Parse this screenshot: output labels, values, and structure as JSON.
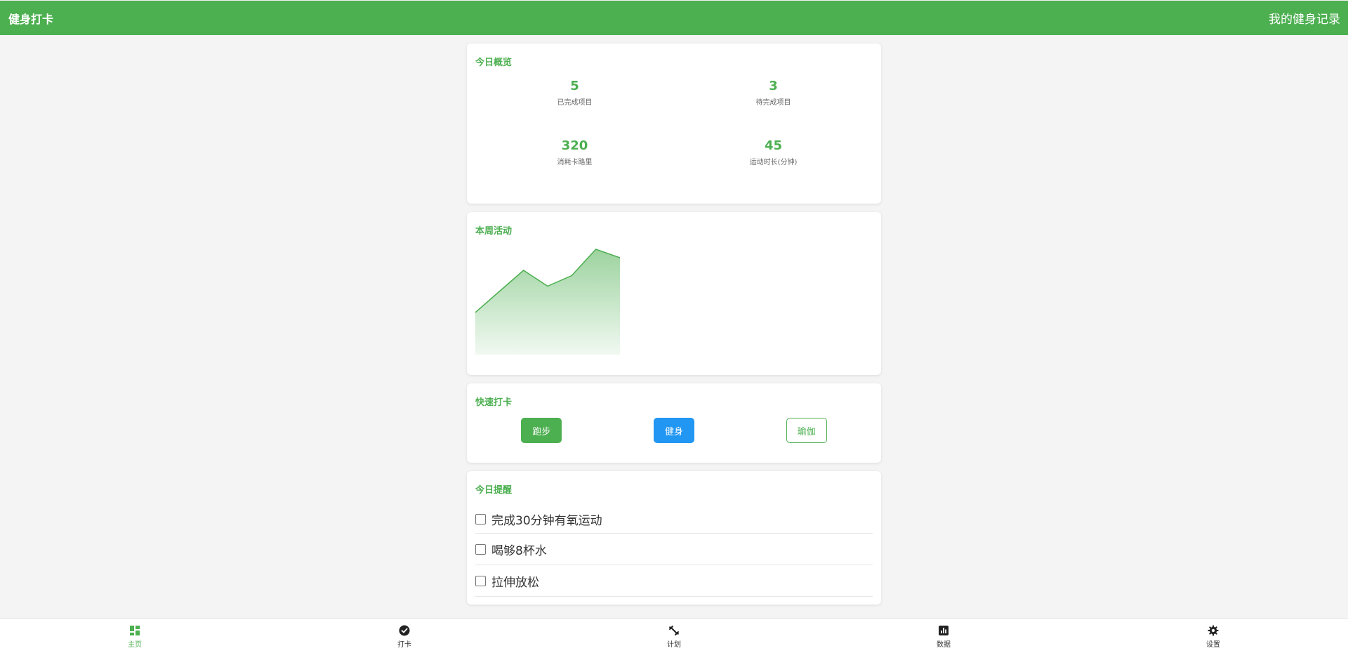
{
  "header": {
    "brand": "健身打卡",
    "title": "我的健身记录"
  },
  "overview": {
    "title": "今日概览",
    "stats": [
      {
        "value": "5",
        "label": "已完成项目"
      },
      {
        "value": "3",
        "label": "待完成项目"
      },
      {
        "value": "320",
        "label": "消耗卡路里"
      },
      {
        "value": "45",
        "label": "运动时长(分钟)"
      }
    ]
  },
  "weekly": {
    "title": "本周活动",
    "chart_data": {
      "type": "area",
      "x": [
        1,
        2,
        3,
        4,
        5,
        6,
        7
      ],
      "values": [
        40,
        60,
        80,
        65,
        75,
        100,
        92
      ],
      "ylim": [
        0,
        100
      ],
      "xlabel": "",
      "ylabel": ""
    }
  },
  "quick": {
    "title": "快速打卡",
    "buttons": [
      {
        "label": "跑步",
        "style": "green"
      },
      {
        "label": "健身",
        "style": "blue"
      },
      {
        "label": "瑜伽",
        "style": "outline"
      }
    ]
  },
  "reminders": {
    "title": "今日提醒",
    "items": [
      "完成30分钟有氧运动",
      "喝够8杯水",
      "拉伸放松"
    ]
  },
  "nav": [
    {
      "label": "主页",
      "icon": "dashboard-icon",
      "active": true
    },
    {
      "label": "打卡",
      "icon": "check-circle-icon",
      "active": false
    },
    {
      "label": "计划",
      "icon": "fitness-icon",
      "active": false
    },
    {
      "label": "数据",
      "icon": "bar-chart-icon",
      "active": false
    },
    {
      "label": "设置",
      "icon": "gear-icon",
      "active": false
    }
  ],
  "colors": {
    "primary": "#4caf50",
    "blue": "#2196f3",
    "background": "#f4f4f4"
  }
}
